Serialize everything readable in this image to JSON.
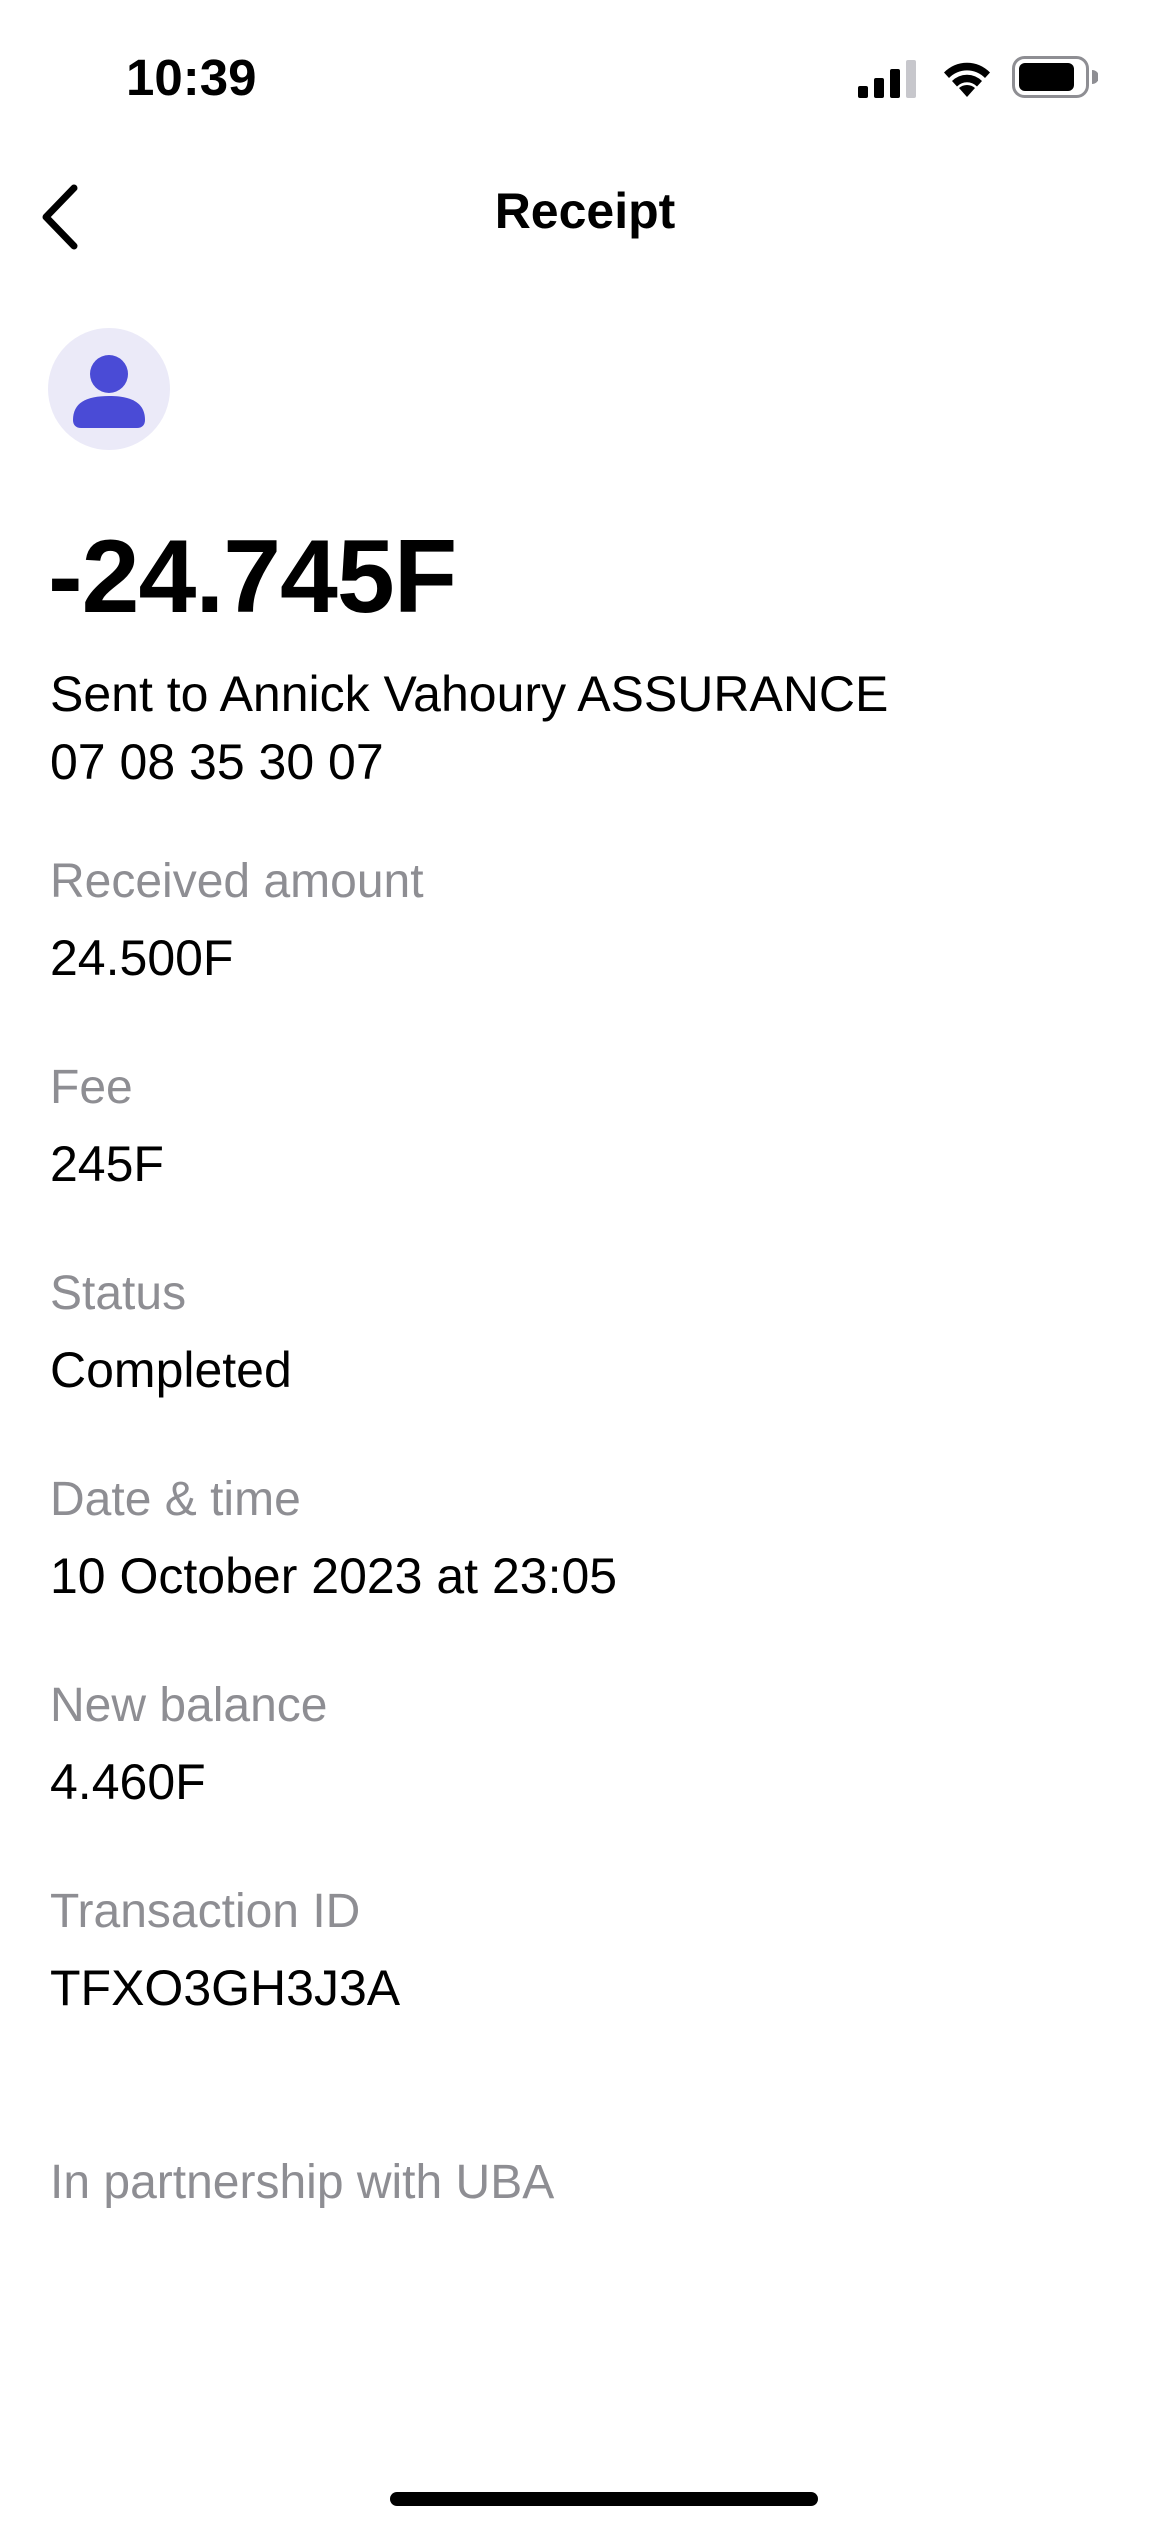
{
  "status_bar": {
    "time": "10:39",
    "icons": [
      "signal-icon",
      "wifi-icon",
      "battery-icon"
    ]
  },
  "nav": {
    "title": "Receipt",
    "back_icon": "chevron-left-icon"
  },
  "avatar": {
    "icon": "person-icon",
    "accent_color": "#4a4bd6",
    "background_color": "#ebeaf8"
  },
  "transaction": {
    "amount": "-24.745F",
    "recipient_line": "Sent to Annick Vahoury ASSURANCE",
    "recipient_phone": "07 08 35 30 07"
  },
  "details": [
    {
      "label": "Received amount",
      "value": "24.500F"
    },
    {
      "label": "Fee",
      "value": "245F"
    },
    {
      "label": "Status",
      "value": "Completed"
    },
    {
      "label": "Date & time",
      "value": "10 October 2023 at 23:05"
    },
    {
      "label": "New balance",
      "value": "4.460F"
    },
    {
      "label": "Transaction ID",
      "value": "TFXO3GH3J3A"
    }
  ],
  "footer": {
    "partner_text": "In partnership with UBA"
  }
}
